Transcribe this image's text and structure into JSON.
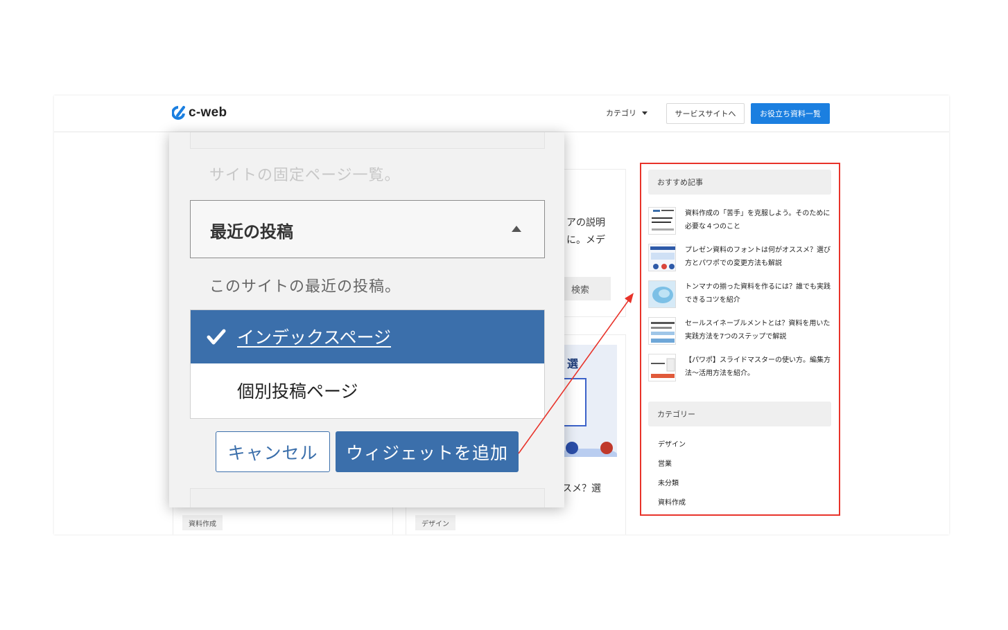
{
  "header": {
    "logo_text": "c-web",
    "nav_category": "カテゴリ",
    "service_button": "サービスサイトへ",
    "resources_button": "お役立ち資料一覧",
    "accent_color": "#1b7fe0"
  },
  "background": {
    "text_line1": "アの説明",
    "text_line2": "に。メデ",
    "search_button": "検索",
    "card_caption": "スメ？選",
    "image_title": "選",
    "tag_left": "資料作成",
    "tag_right": "デザイン"
  },
  "modal": {
    "faded_text": "サイトの固定ページ一覧。",
    "select_label": "最近の投稿",
    "description": "このサイトの最近の投稿。",
    "options": [
      {
        "label": "インデックスページ",
        "selected": true
      },
      {
        "label": "個別投稿ページ",
        "selected": false
      }
    ],
    "cancel_button": "キャンセル",
    "add_button": "ウィジェットを追加",
    "primary_color": "#3b6fab"
  },
  "sidebar": {
    "highlight_color": "#e8332a",
    "recommended_heading": "おすすめ記事",
    "posts": [
      {
        "title": "資料作成の「苦手」を克服しよう。そのために必要な４つのこと"
      },
      {
        "title": "プレゼン資料のフォントは何がオススメ？選び方とパワポでの変更方法も解説"
      },
      {
        "title": "トンマナの揃った資料を作るには？誰でも実践できるコツを紹介"
      },
      {
        "title": "セールスイネーブルメントとは？資料を用いた実践方法を7つのステップで解説"
      },
      {
        "title": "【パワポ】スライドマスターの使い方。編集方法〜活用方法を紹介。"
      }
    ],
    "category_heading": "カテゴリー",
    "categories": [
      "デザイン",
      "営業",
      "未分類",
      "資料作成"
    ]
  }
}
